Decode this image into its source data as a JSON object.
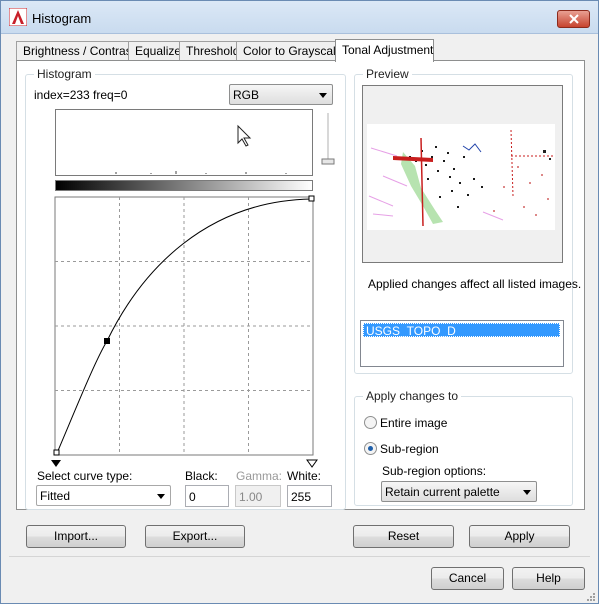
{
  "window": {
    "title": "Histogram"
  },
  "tabs": [
    {
      "label": "Brightness / Contrast"
    },
    {
      "label": "Equalize"
    },
    {
      "label": "Threshold"
    },
    {
      "label": "Color to Grayscale"
    },
    {
      "label": "Tonal Adjustment"
    }
  ],
  "histogram": {
    "group_label": "Histogram",
    "info": "index=233 freq=0",
    "channel": "RGB"
  },
  "curve": {
    "type_label": "Select curve type:",
    "type_value": "Fitted",
    "black_label": "Black:",
    "black_value": "0",
    "gamma_label": "Gamma:",
    "gamma_value": "1.00",
    "white_label": "White:",
    "white_value": "255"
  },
  "preview": {
    "group_label": "Preview",
    "note": "Applied changes affect all listed images.",
    "images": [
      "USGS_TOPO_D"
    ]
  },
  "apply_changes": {
    "group_label": "Apply changes to",
    "options": [
      {
        "label": "Entire image",
        "selected": false
      },
      {
        "label": "Sub-region",
        "selected": true
      }
    ],
    "subregion_label": "Sub-region options:",
    "subregion_value": "Retain current palette"
  },
  "buttons": {
    "import": "Import...",
    "export": "Export...",
    "reset": "Reset",
    "apply": "Apply",
    "cancel": "Cancel",
    "help": "Help"
  },
  "colors": {
    "selection": "#3399ff",
    "close": "#c7432e",
    "app_icon": "#c8202a"
  }
}
